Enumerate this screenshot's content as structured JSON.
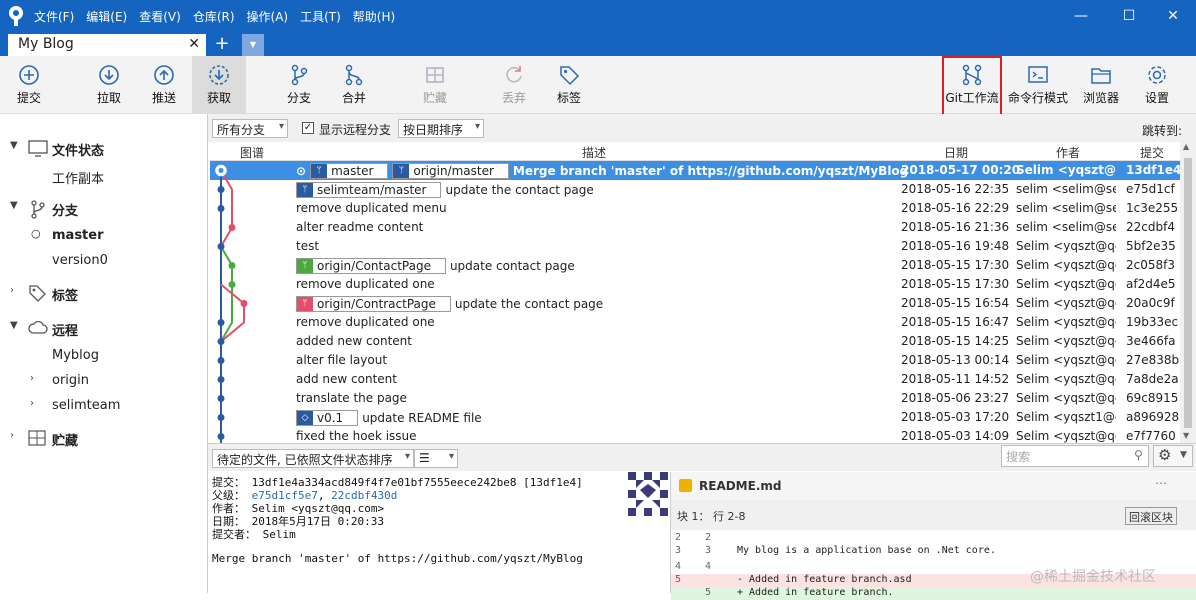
{
  "window": {
    "tab_title": "My Blog"
  },
  "menu": [
    "文件(F)",
    "编辑(E)",
    "查看(V)",
    "仓库(R)",
    "操作(A)",
    "工具(T)",
    "帮助(H)"
  ],
  "toolbar": {
    "commit": "提交",
    "pull": "拉取",
    "push": "推送",
    "fetch": "获取",
    "branch": "分支",
    "merge": "合并",
    "stash": "贮藏",
    "discard": "丢弃",
    "tag": "标签",
    "gitflow": "Git工作流",
    "terminal": "命令行模式",
    "explorer": "浏览器",
    "settings": "设置"
  },
  "sidebar": {
    "file_status": "文件状态",
    "working_copy": "工作副本",
    "branches": "分支",
    "master": "master",
    "version0": "version0",
    "tags": "标签",
    "remotes": "远程",
    "myblog": "Myblog",
    "origin": "origin",
    "selimteam": "selimteam",
    "stashes": "贮藏"
  },
  "filter": {
    "branches": "所有分支",
    "show_remote": "显示远程分支",
    "sort": "按日期排序",
    "jump": "跳转到:"
  },
  "columns": {
    "graph": "图谱",
    "desc": "描述",
    "date": "日期",
    "author": "作者",
    "commit": "提交"
  },
  "commits": [
    {
      "refs": [
        {
          "name": "master",
          "kind": "branch"
        },
        {
          "name": "origin/master",
          "kind": "branch"
        }
      ],
      "msg": "Merge branch 'master' of https://github.com/yqszt/MyBlog",
      "date": "2018-05-17 00:20",
      "author": "Selim <yqszt@qq",
      "hash": "13df1e4"
    },
    {
      "refs": [
        {
          "name": "selimteam/master",
          "kind": "branch"
        }
      ],
      "msg": "update the contact page",
      "date": "2018-05-16 22:35",
      "author": "selim <selim@se",
      "hash": "e75d1cf"
    },
    {
      "refs": [],
      "msg": "remove duplicated menu",
      "date": "2018-05-16 22:29",
      "author": "selim <selim@se",
      "hash": "1c3e255"
    },
    {
      "refs": [],
      "msg": "alter readme content",
      "date": "2018-05-16 21:36",
      "author": "selim <selim@se",
      "hash": "22cdbf4"
    },
    {
      "refs": [],
      "msg": "test",
      "date": "2018-05-16 19:48",
      "author": "Selim <yqszt@qc",
      "hash": "5bf2e35"
    },
    {
      "refs": [
        {
          "name": "origin/ContactPage",
          "kind": "green"
        }
      ],
      "msg": "update contact page",
      "date": "2018-05-15 17:30",
      "author": "Selim <yqszt@qc",
      "hash": "2c058f3"
    },
    {
      "refs": [],
      "msg": "remove duplicated one",
      "date": "2018-05-15 17:30",
      "author": "Selim <yqszt@qc",
      "hash": "af2d4e5"
    },
    {
      "refs": [
        {
          "name": "origin/ContractPage",
          "kind": "red"
        }
      ],
      "msg": "update the contact page",
      "date": "2018-05-15 16:54",
      "author": "Selim <yqszt@qc",
      "hash": "20a0c9f"
    },
    {
      "refs": [],
      "msg": "remove duplicated one",
      "date": "2018-05-15 16:47",
      "author": "Selim <yqszt@qc",
      "hash": "19b33ec"
    },
    {
      "refs": [],
      "msg": "added new content",
      "date": "2018-05-15 14:25",
      "author": "Selim <yqszt@qc",
      "hash": "3e466fa"
    },
    {
      "refs": [],
      "msg": "alter file layout",
      "date": "2018-05-13 00:14",
      "author": "Selim <yqszt@qc",
      "hash": "27e838b"
    },
    {
      "refs": [],
      "msg": "add new content",
      "date": "2018-05-11 14:52",
      "author": "Selim <yqszt@qc",
      "hash": "7a8de2a"
    },
    {
      "refs": [],
      "msg": "translate the page",
      "date": "2018-05-06 23:27",
      "author": "Selim <yqszt@qc",
      "hash": "69c8915"
    },
    {
      "refs": [
        {
          "name": "v0.1",
          "kind": "tag"
        }
      ],
      "msg": "update README file",
      "date": "2018-05-03 17:20",
      "author": "Selim <yqszt1@c",
      "hash": "a896928"
    },
    {
      "refs": [],
      "msg": "fixed the hoek issue",
      "date": "2018-05-03 14:09",
      "author": "Selim <yqszt@qc",
      "hash": "e7f7760"
    }
  ],
  "bottom": {
    "pending": "待定的文件, 已依照文件状态排序",
    "search_placeholder": "搜索"
  },
  "detail": {
    "commit_line": "提交： 13df1e4a334acd849f4f7e01bf7555eece242be8 [13df1e4]",
    "parents_label": "父级：",
    "parent1": "e75d1cf5e7",
    "parent2": "22cdbf430d",
    "author_line": "作者： Selim <yqszt@qq.com>",
    "date_line": "日期： 2018年5月17日 0:20:33",
    "committer_line": "提交者： Selim",
    "message": "Merge branch 'master' of https://github.com/yqszt/MyBlog"
  },
  "diff": {
    "file": "README.md",
    "hunk": "块 1： 行 2-8",
    "hunk_button": "回滚区块",
    "lines": [
      {
        "n1": "2",
        "n2": "2",
        "text": "",
        "kind": "ctx"
      },
      {
        "n1": "3",
        "n2": "3",
        "text": "My blog is a application base on .Net core.",
        "kind": "ctx"
      },
      {
        "n1": "4",
        "n2": "4",
        "text": "",
        "kind": "ctx"
      },
      {
        "n1": "5",
        "n2": "",
        "text": "- Added in feature branch.asd",
        "kind": "del"
      },
      {
        "n1": "",
        "n2": "5",
        "text": "+ Added in feature branch.",
        "kind": "add"
      }
    ]
  },
  "watermark": "@稀土掘金技术社区"
}
